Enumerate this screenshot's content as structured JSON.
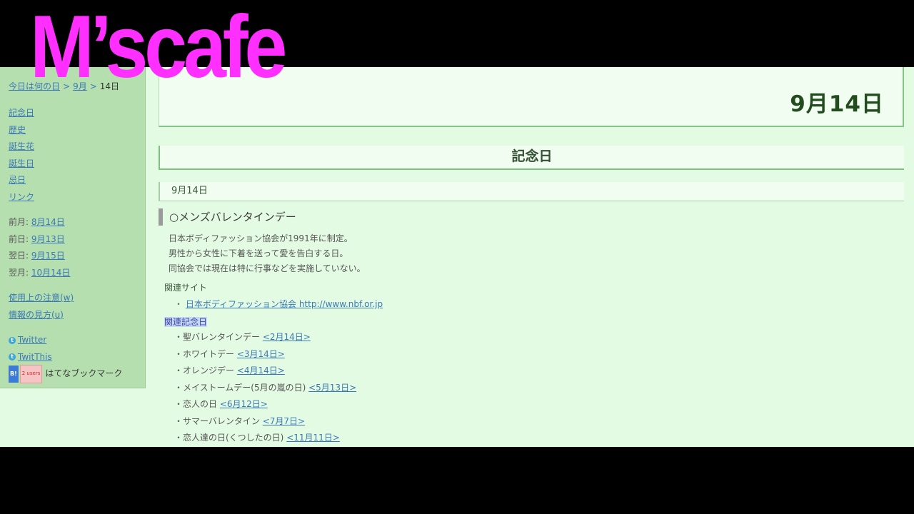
{
  "overlay": {
    "logo_text": "M’scafe"
  },
  "sidebar": {
    "breadcrumb": {
      "home": "今日は何の日",
      "month": "9月",
      "day": "14日",
      "sep1": ">",
      "sep2": ">"
    },
    "menu": [
      "記念日",
      "歴史",
      "誕生花",
      "誕生日",
      "忌日",
      "リンク"
    ],
    "nav": [
      {
        "label": "前月:",
        "link": "8月14日"
      },
      {
        "label": "前日:",
        "link": "9月13日"
      },
      {
        "label": "翌日:",
        "link": "9月15日"
      },
      {
        "label": "翌月:",
        "link": "10月14日"
      }
    ],
    "help": [
      "使用上の注意(w)",
      "情報の見方(u)"
    ],
    "social": {
      "twitter": "Twitter",
      "twitthis": "TwitThis",
      "hatena_icon": "B!",
      "hatena_users": "2 users",
      "hatena_label": "はてなブックマーク"
    }
  },
  "main": {
    "date_title": "9月14日",
    "section_title": "記念日",
    "sub_date": "9月14日",
    "entry": {
      "title": "○メンズバレンタインデー",
      "desc": [
        "日本ボディファッション協会が1991年に制定。",
        "男性から女性に下着を送って愛を告白する日。",
        "同協会では現在は特に行事などを実施していない。"
      ],
      "related_sites_label": "関連サイト",
      "related_site": {
        "bullet": "・",
        "name": "日本ボディファッション協会 http://www.nbf.or.jp"
      },
      "related_days_label": "関連記念日",
      "related_days": [
        {
          "name": "・聖バレンタインデー",
          "link": "<2月14日>"
        },
        {
          "name": "・ホワイトデー",
          "link": "<3月14日>"
        },
        {
          "name": "・オレンジデー",
          "link": "<4月14日>"
        },
        {
          "name": "・メイストームデー(5月の嵐の日)",
          "link": "<5月13日>"
        },
        {
          "name": "・恋人の日",
          "link": "<6月12日>"
        },
        {
          "name": "・サマーバレンタイン",
          "link": "<7月7日>"
        },
        {
          "name": "・恋人達の日(くつしたの日)",
          "link": "<11月11日>"
        }
      ]
    }
  }
}
